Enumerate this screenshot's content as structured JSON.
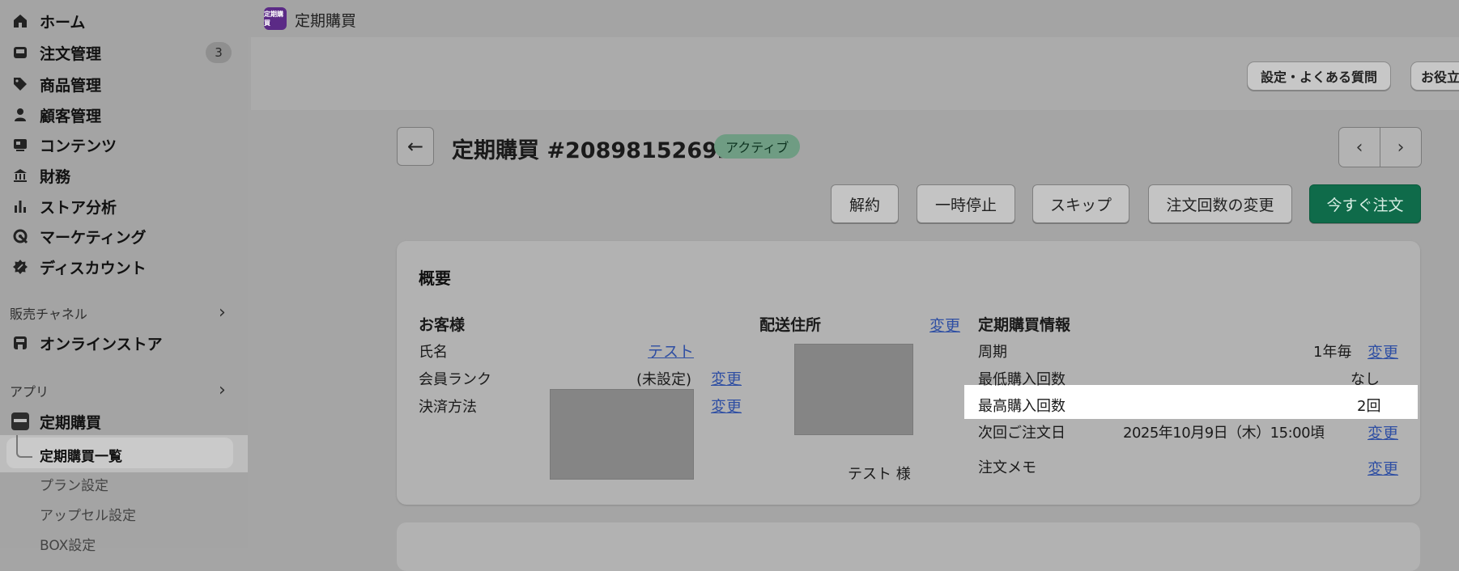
{
  "sidebar": {
    "items": [
      {
        "label": "ホーム",
        "icon": "home-icon"
      },
      {
        "label": "注文管理",
        "icon": "inbox-icon",
        "badge": "3"
      },
      {
        "label": "商品管理",
        "icon": "tag-icon"
      },
      {
        "label": "顧客管理",
        "icon": "person-icon"
      },
      {
        "label": "コンテンツ",
        "icon": "content-icon"
      },
      {
        "label": "財務",
        "icon": "bank-icon"
      },
      {
        "label": "ストア分析",
        "icon": "bar-chart-icon"
      },
      {
        "label": "マーケティング",
        "icon": "target-icon"
      },
      {
        "label": "ディスカウント",
        "icon": "discount-icon"
      }
    ],
    "sales_channels_label": "販売チャネル",
    "online_store_label": "オンラインストア",
    "apps_label": "アプリ",
    "app_name": "定期購買",
    "app_sub_items": [
      "定期購買一覧",
      "プラン設定",
      "アップセル設定",
      "BOX設定"
    ]
  },
  "topbar": {
    "app_title": "定期購買",
    "logo_text": "定期購買",
    "buttons": [
      "設定・よくある質問",
      "お役立"
    ]
  },
  "header": {
    "title": "定期購買 #20898152692",
    "status": "アクティブ",
    "back_icon": "arrow-left-icon",
    "prev_icon": "chevron-left-icon",
    "next_icon": "chevron-right-icon"
  },
  "actions": [
    "解約",
    "一時停止",
    "スキップ",
    "注文回数の変更",
    "今すぐ注文"
  ],
  "overview": {
    "title": "概要",
    "customer": {
      "heading": "お客様",
      "name_label": "氏名",
      "name_value": "テスト",
      "rank_label": "会員ランク",
      "rank_value": "(未設定)",
      "payment_label": "決済方法",
      "change": "変更"
    },
    "shipping": {
      "heading": "配送住所",
      "change": "変更",
      "recipient": "テスト 様"
    },
    "subscription": {
      "heading": "定期購買情報",
      "rows": [
        {
          "label": "周期",
          "value": "1年毎",
          "link": "変更"
        },
        {
          "label": "最低購入回数",
          "value": "なし",
          "link": ""
        },
        {
          "label": "最高購入回数",
          "value": "2回",
          "link": ""
        },
        {
          "label": "次回ご注文日",
          "value": "2025年10月9日（木）15:00頃",
          "link": "変更"
        },
        {
          "label": "注文メモ",
          "value": "",
          "link": "変更"
        }
      ]
    }
  },
  "colors": {
    "primary": "#0f6b4a",
    "status": "#6f9c83",
    "link": "#2f4fa3"
  }
}
